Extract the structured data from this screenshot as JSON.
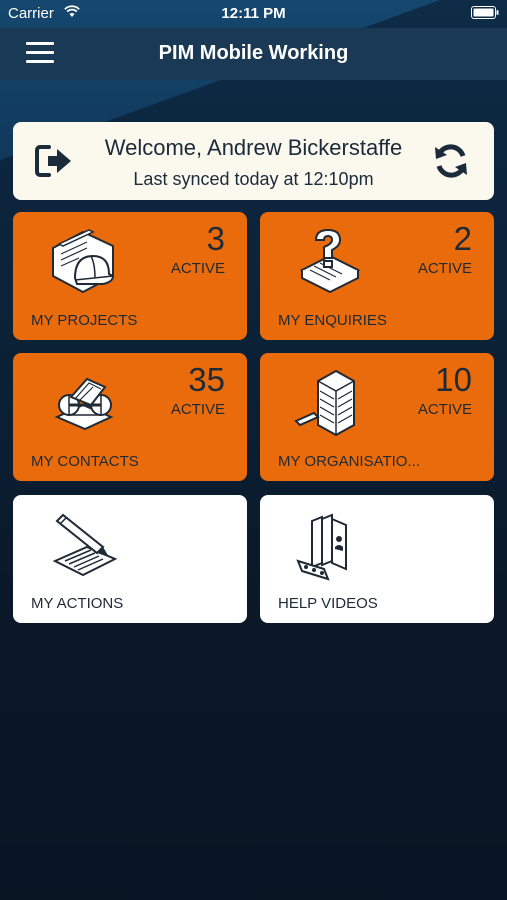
{
  "status_bar": {
    "carrier": "Carrier",
    "time": "12:11 PM"
  },
  "header": {
    "title": "PIM Mobile Working"
  },
  "welcome": {
    "greeting": "Welcome, Andrew Bickerstaffe",
    "sync": "Last synced today at 12:10pm"
  },
  "tiles": [
    {
      "label": "MY PROJECTS",
      "count": "3",
      "status": "ACTIVE",
      "illustration": "construction-helmet-blueprints"
    },
    {
      "label": "MY ENQUIRIES",
      "count": "2",
      "status": "ACTIVE",
      "illustration": "question-mark-documents"
    },
    {
      "label": "MY CONTACTS",
      "count": "35",
      "status": "ACTIVE",
      "illustration": "rolodex"
    },
    {
      "label": "MY ORGANISATIO...",
      "count": "10",
      "status": "ACTIVE",
      "illustration": "office-building"
    },
    {
      "label": "MY ACTIONS",
      "illustration": "pencil-notepad"
    },
    {
      "label": "HELP VIDEOS",
      "illustration": "books-film-strip"
    }
  ],
  "colors": {
    "accent": "#ea6b0c",
    "navbar": "#1a3954",
    "card": "#fbf8ee",
    "text_dark": "#1e2a36"
  }
}
